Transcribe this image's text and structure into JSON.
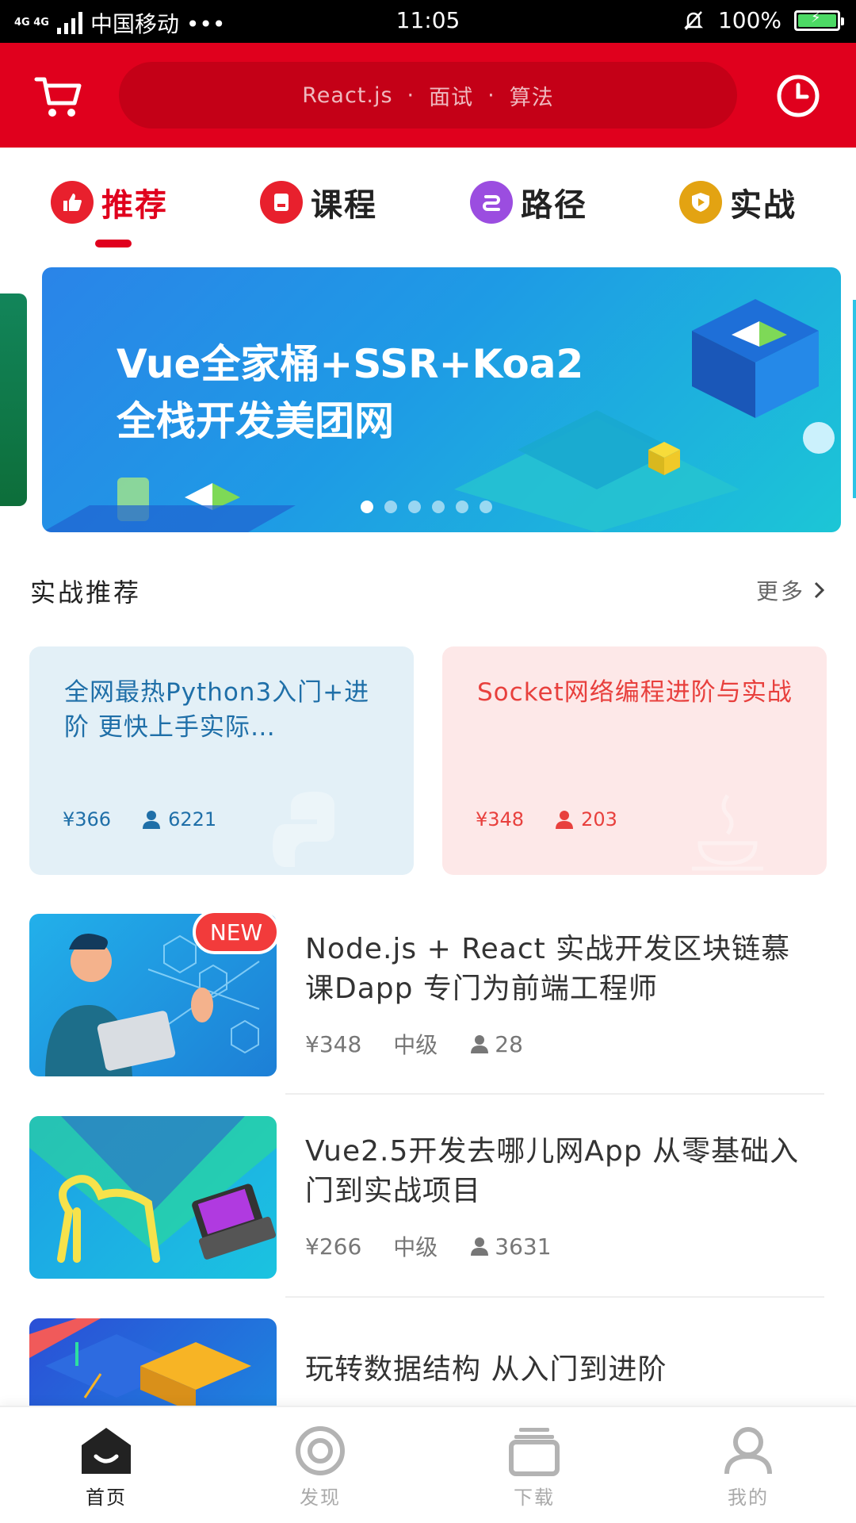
{
  "status_bar": {
    "network": "4G 4G",
    "carrier": "中国移动 •••",
    "time": "11:05",
    "battery": "100%"
  },
  "header": {
    "search_placeholder_parts": [
      "React.js",
      "面试",
      "算法"
    ],
    "cart_icon": "cart-icon",
    "history_icon": "clock-icon"
  },
  "category_tabs": [
    {
      "label": "推荐",
      "icon": "thumbs-up-icon",
      "color": "#e8202d",
      "active": true
    },
    {
      "label": "课程",
      "icon": "course-book-icon",
      "color": "#e8202d",
      "active": false
    },
    {
      "label": "路径",
      "icon": "route-icon",
      "color": "#9b4de0",
      "active": false
    },
    {
      "label": "实战",
      "icon": "shield-play-icon",
      "color": "#e3a312",
      "active": false
    }
  ],
  "banner": {
    "line1": "Vue全家桶+SSR+Koa2",
    "line2": "全栈开发美团网",
    "dots": 6,
    "active_dot": 0
  },
  "section": {
    "title": "实战推荐",
    "more": "更多"
  },
  "featured": [
    {
      "title": "全网最热Python3入门+进阶 更快上手实际…",
      "price": "¥366",
      "students": "6221"
    },
    {
      "title": "Socket网络编程进阶与实战",
      "price": "¥348",
      "students": "203"
    }
  ],
  "courses": [
    {
      "title": "Node.js + React 实战开发区块链慕课Dapp 专门为前端工程师",
      "price": "¥348",
      "level": "中级",
      "students": "28",
      "badge": "NEW"
    },
    {
      "title": " Vue2.5开发去哪儿网App 从零基础入门到实战项目",
      "price": "¥266",
      "level": "中级",
      "students": "3631"
    },
    {
      "title": "玩转数据结构 从入门到进阶"
    }
  ],
  "bottom_nav": [
    {
      "label": "首页",
      "icon": "home-icon",
      "active": true
    },
    {
      "label": "发现",
      "icon": "discover-icon",
      "active": false
    },
    {
      "label": "下载",
      "icon": "download-stack-icon",
      "active": false
    },
    {
      "label": "我的",
      "icon": "profile-icon",
      "active": false
    }
  ],
  "colors": {
    "brand_red": "#e0001d",
    "featured_blue": "#1f6fa8",
    "featured_red": "#e8403d"
  }
}
